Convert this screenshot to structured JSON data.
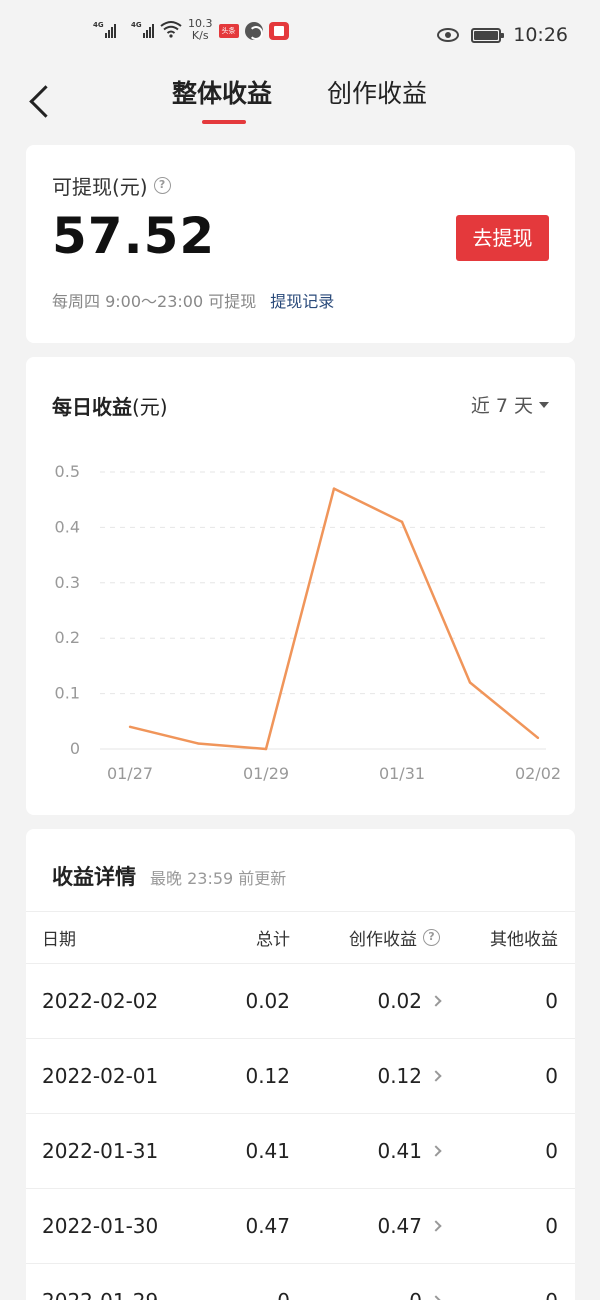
{
  "status_bar": {
    "net1": "4G",
    "net2": "4G",
    "speed_value": "10.3",
    "speed_unit": "K/s",
    "app_badge": "头条",
    "time": "10:26"
  },
  "header": {
    "tabs": [
      {
        "label": "整体收益",
        "active": true
      },
      {
        "label": "创作收益",
        "active": false
      }
    ]
  },
  "withdraw": {
    "label": "可提现(元)",
    "amount": "57.52",
    "button_label": "去提现",
    "note": "每周四 9:00～23:00 可提现",
    "record_link": "提现记录"
  },
  "daily_chart": {
    "title_bold": "每日收益",
    "title_unit": "(元)",
    "range_label": "近 7 天"
  },
  "chart_data": {
    "type": "line",
    "x": [
      "01/27",
      "01/28",
      "01/29",
      "01/30",
      "01/31",
      "02/01",
      "02/02"
    ],
    "x_tick_labels": [
      "01/27",
      "01/29",
      "01/31",
      "02/02"
    ],
    "series": [
      {
        "values": [
          0.04,
          0.01,
          0,
          0.47,
          0.41,
          0.12,
          0.02
        ],
        "color": "#f0955a"
      }
    ],
    "y_ticks": [
      "0",
      "0.1",
      "0.2",
      "0.3",
      "0.4",
      "0.5"
    ],
    "ylim": [
      0,
      0.5
    ],
    "grid": true,
    "title": "每日收益",
    "xlabel": "",
    "ylabel": "(元)"
  },
  "details": {
    "title": "收益详情",
    "subtitle": "最晚 23:59 前更新",
    "columns": {
      "date": "日期",
      "total": "总计",
      "creation": "创作收益",
      "other": "其他收益"
    },
    "rows": [
      {
        "date": "2022-02-02",
        "total": "0.02",
        "creation": "0.02",
        "other": "0"
      },
      {
        "date": "2022-02-01",
        "total": "0.12",
        "creation": "0.12",
        "other": "0"
      },
      {
        "date": "2022-01-31",
        "total": "0.41",
        "creation": "0.41",
        "other": "0"
      },
      {
        "date": "2022-01-30",
        "total": "0.47",
        "creation": "0.47",
        "other": "0"
      },
      {
        "date": "2022-01-29",
        "total": "0",
        "creation": "0",
        "other": "0"
      }
    ]
  },
  "colors": {
    "accent": "#e4393c",
    "line": "#f0955a",
    "link": "#2a4a7a",
    "background": "#f3f3f3"
  }
}
